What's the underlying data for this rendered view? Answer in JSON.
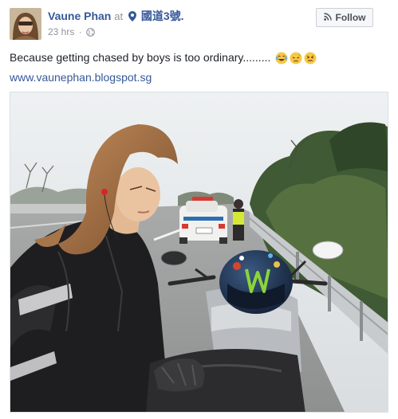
{
  "post": {
    "author": "Vaune Phan",
    "at_text": "at",
    "place": "國道3號.",
    "timestamp": "23 hrs",
    "separator": "·",
    "follow_label": "Follow",
    "caption": "Because getting chased by boys is too ordinary.........",
    "link": "www.vaunephan.blogspot.sg",
    "icons": {
      "location": "map-pin-icon",
      "privacy": "globe-icon",
      "follow": "rss-follow-icon",
      "emojis": [
        "laughing-tears-emoji",
        "sad-sweat-emoji",
        "confounded-emoji"
      ]
    },
    "colors": {
      "link": "#365899",
      "muted": "#90949c",
      "text": "#1d2129"
    }
  }
}
